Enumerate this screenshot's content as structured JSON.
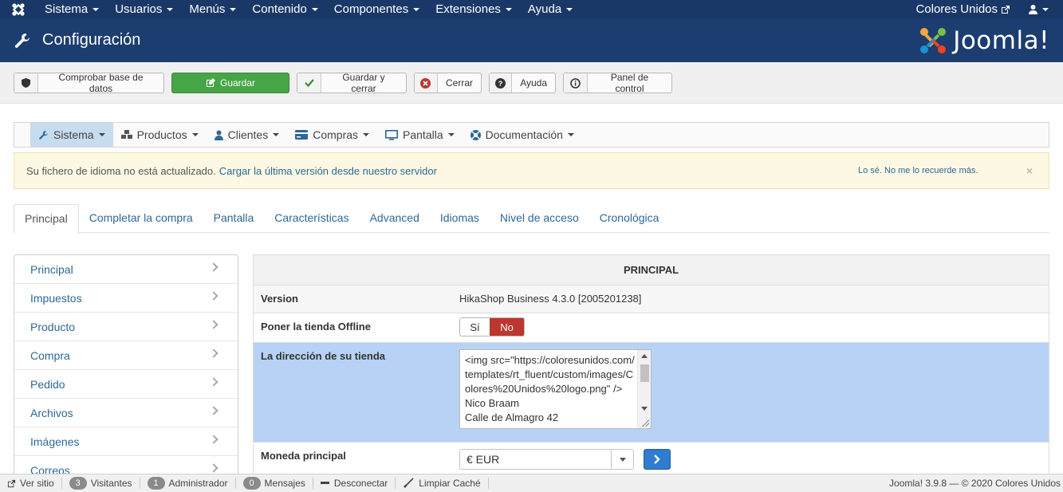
{
  "topbar": {
    "menu": [
      {
        "label": "Sistema"
      },
      {
        "label": "Usuarios"
      },
      {
        "label": "Menús"
      },
      {
        "label": "Contenido"
      },
      {
        "label": "Componentes"
      },
      {
        "label": "Extensiones"
      },
      {
        "label": "Ayuda"
      }
    ],
    "site_name": "Colores Unidos",
    "user_icon": "user-icon"
  },
  "header": {
    "title": "Configuración",
    "brand": "Joomla!",
    "title_icon": "wrench-icon"
  },
  "toolbar": {
    "check_db": "Comprobar base de datos",
    "save": "Guardar",
    "save_close": "Guardar y cerrar",
    "close": "Cerrar",
    "help": "Ayuda",
    "control_panel": "Panel de control",
    "save_color": "#46a546"
  },
  "hikamenu": [
    {
      "label": "Sistema",
      "icon": "wrench-icon",
      "active": true
    },
    {
      "label": "Productos",
      "icon": "cubes-icon"
    },
    {
      "label": "Clientes",
      "icon": "user-icon"
    },
    {
      "label": "Compras",
      "icon": "credit-card-icon"
    },
    {
      "label": "Pantalla",
      "icon": "monitor-icon"
    },
    {
      "label": "Documentación",
      "icon": "lifebuoy-icon"
    }
  ],
  "alert": {
    "message": "Su fichero de idioma no está actualizado.",
    "link": "Cargar la última versión desde nuestro servidor",
    "dismiss": "Lo sé. No me lo recuerde más.",
    "close": "×"
  },
  "tabs": [
    {
      "label": "Principal",
      "active": true
    },
    {
      "label": "Completar la compra"
    },
    {
      "label": "Pantalla"
    },
    {
      "label": "Características"
    },
    {
      "label": "Advanced"
    },
    {
      "label": "Idiomas"
    },
    {
      "label": "Nivel de acceso"
    },
    {
      "label": "Cronológica"
    }
  ],
  "sidelist": [
    {
      "label": "Principal"
    },
    {
      "label": "Impuestos"
    },
    {
      "label": "Producto"
    },
    {
      "label": "Compra"
    },
    {
      "label": "Pedido"
    },
    {
      "label": "Archivos"
    },
    {
      "label": "Imágenes"
    },
    {
      "label": "Correos"
    }
  ],
  "config": {
    "heading": "PRINCIPAL",
    "version_label": "Version",
    "version_value": "HikaShop Business 4.3.0 [2005201238]",
    "offline_label": "Poner la tienda Offline",
    "offline_yes": "Sí",
    "offline_no": "No",
    "address_label": "La dirección de su tienda",
    "address_value": "<img src=\"https://coloresunidos.com/templates/rt_fluent/custom/images/Colores%20Unidos%20logo.png\" />\nNico Braam\nCalle de Almagro 42",
    "currency_label": "Moneda principal",
    "currency_value": "€ EUR"
  },
  "statusbar": {
    "view_site": "Ver sitio",
    "visitors_count": "3",
    "visitors": "Visitantes",
    "admin_count": "1",
    "admin": "Administrador",
    "messages_count": "0",
    "messages": "Mensajes",
    "logout": "Desconectar",
    "clear_cache": "Limpiar Caché",
    "footer": "Joomla! 3.9.8 — © 2020 Colores Unidos"
  }
}
